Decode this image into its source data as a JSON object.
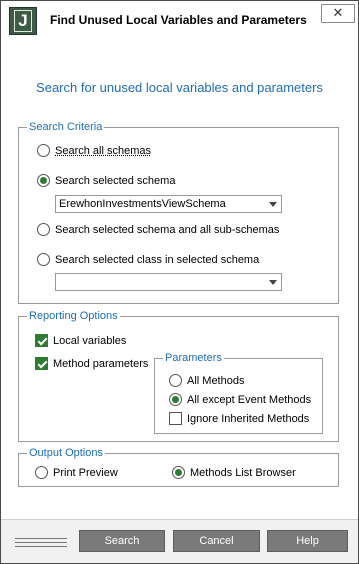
{
  "window": {
    "title": "Find Unused Local Variables and Parameters",
    "logo_letter": "J",
    "close_glyph": "✕"
  },
  "header": {
    "text": "Search for unused local variables and parameters"
  },
  "search_criteria": {
    "legend": "Search Criteria",
    "options": [
      {
        "label": "Search all schemas",
        "checked": false
      },
      {
        "label": "Search selected schema",
        "checked": true
      },
      {
        "label": "Search selected schema and all sub-schemas",
        "checked": false
      },
      {
        "label": "Search selected class in selected schema",
        "checked": false
      }
    ],
    "schema_combo_value": "ErewhonInvestmentsViewSchema",
    "class_combo_value": ""
  },
  "reporting_options": {
    "legend": "Reporting Options",
    "local_variables": {
      "label": "Local variables",
      "checked": true
    },
    "method_parameters": {
      "label": "Method parameters",
      "checked": true
    },
    "parameters": {
      "legend": "Parameters",
      "all_methods": {
        "label": "All Methods",
        "checked": false
      },
      "all_except_event": {
        "label": "All except Event Methods",
        "checked": true
      },
      "ignore_inherited": {
        "label": "Ignore Inherited Methods",
        "checked": false
      }
    }
  },
  "output_options": {
    "legend": "Output Options",
    "print_preview": {
      "label": "Print Preview",
      "checked": false
    },
    "methods_list_browser": {
      "label": "Methods List Browser",
      "checked": true
    }
  },
  "footer": {
    "search_label": "Search",
    "cancel_label": "Cancel",
    "help_label": "Help"
  }
}
